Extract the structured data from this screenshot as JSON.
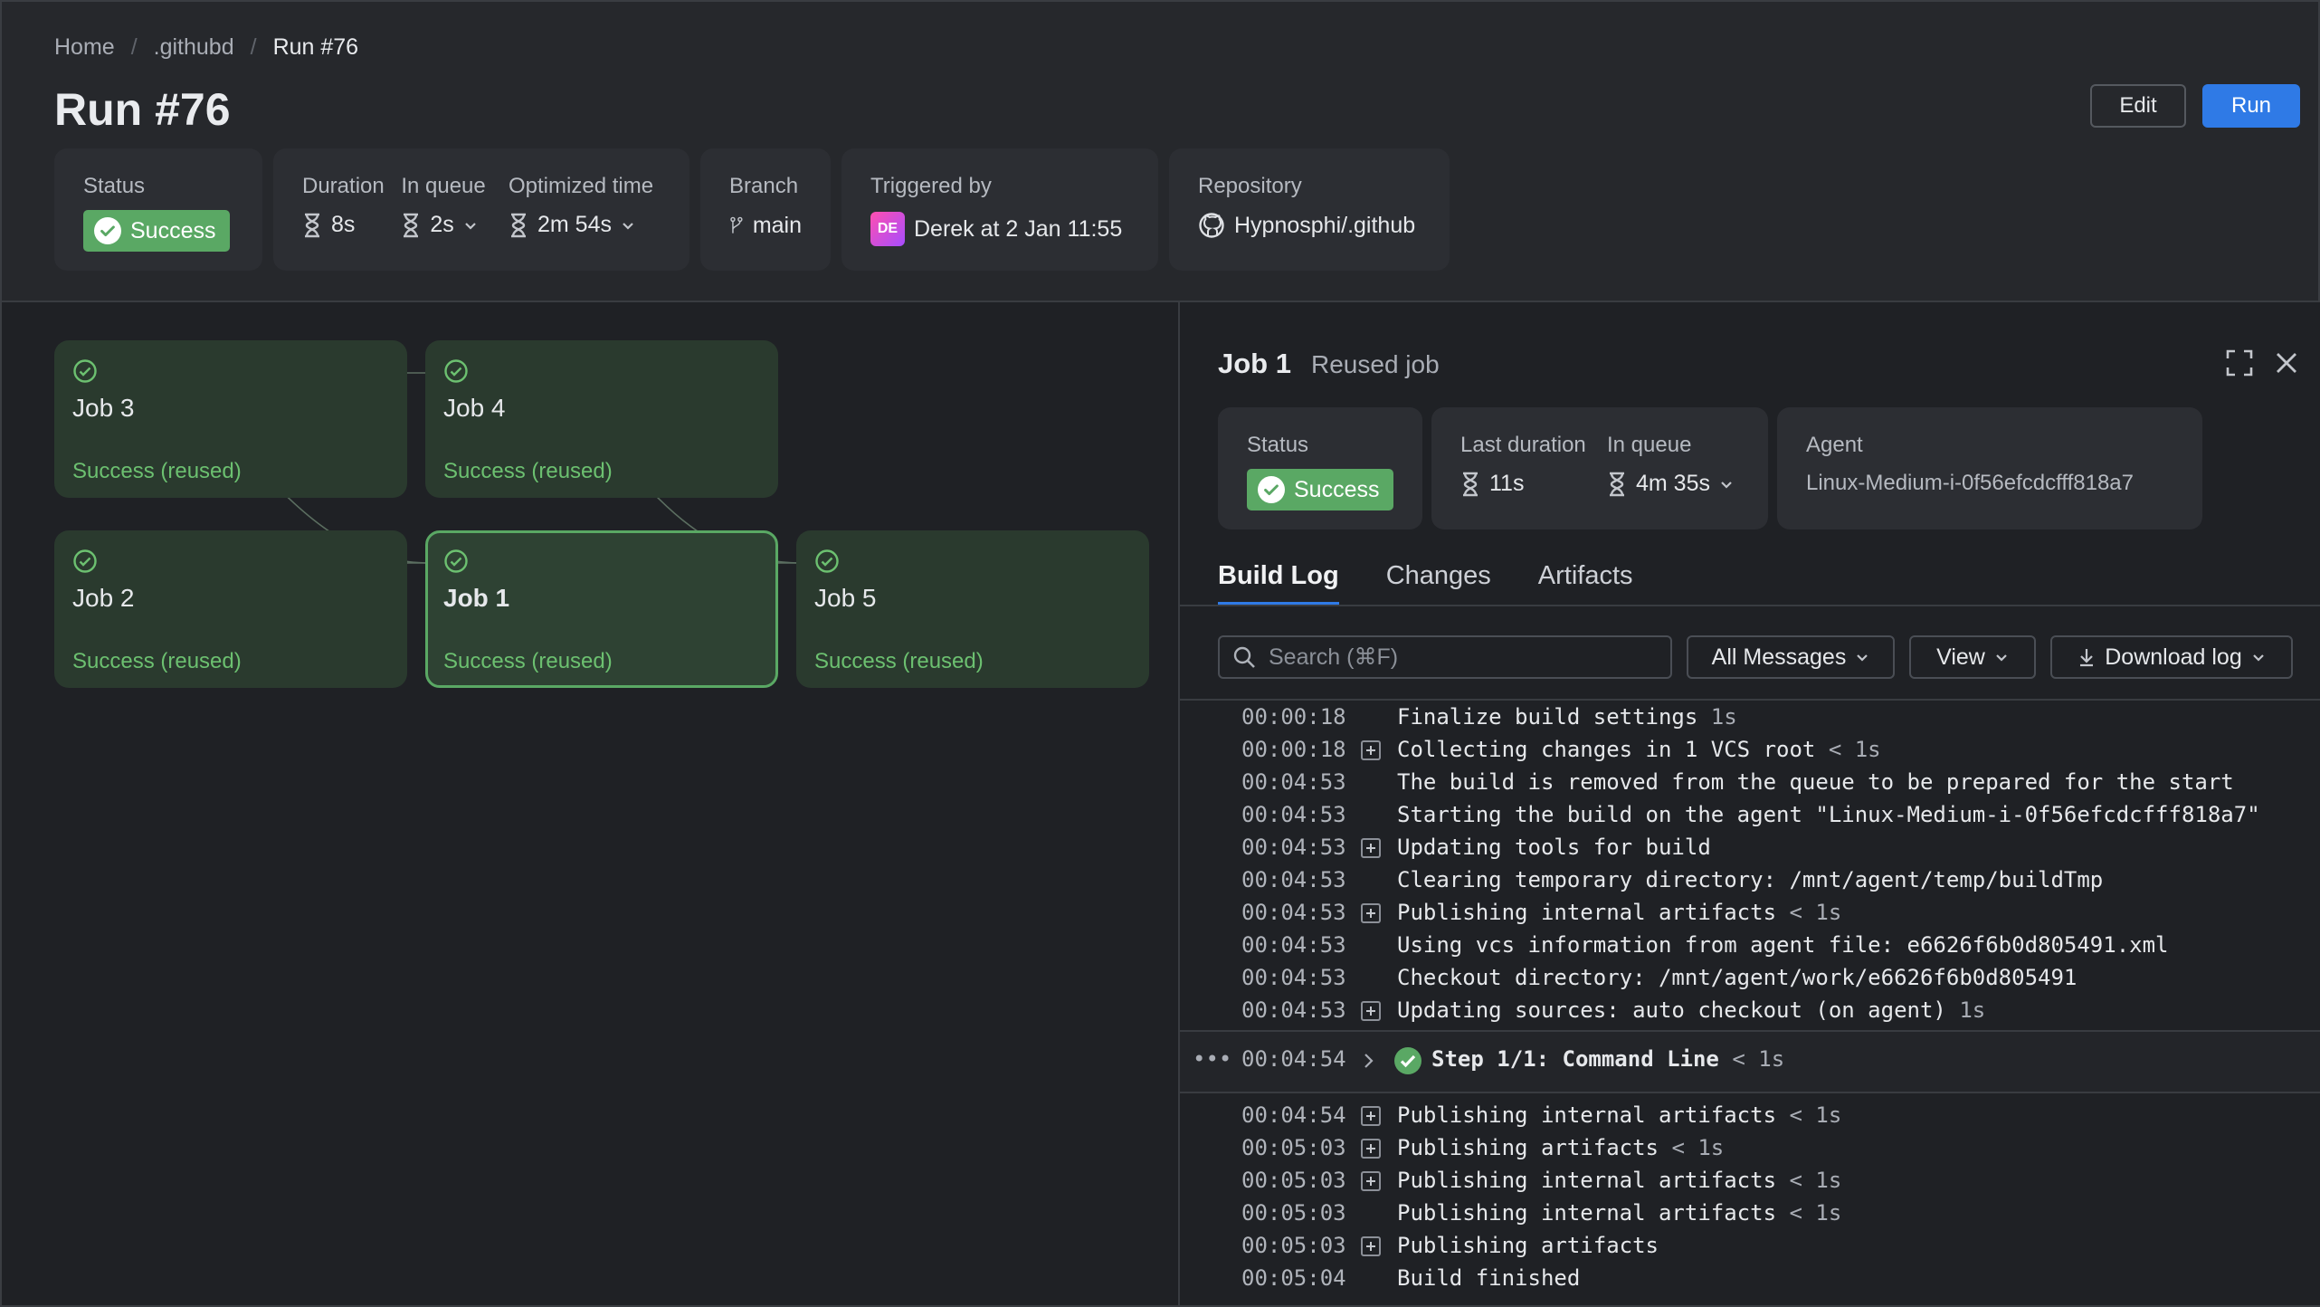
{
  "breadcrumb": {
    "home": "Home",
    "project": ".githubd",
    "current": "Run #76"
  },
  "page": {
    "title": "Run #76",
    "edit_label": "Edit",
    "run_label": "Run"
  },
  "summary": {
    "status_label": "Status",
    "status_value": "Success",
    "duration_label": "Duration",
    "duration_value": "8s",
    "queue_label": "In queue",
    "queue_value": "2s",
    "optimized_label": "Optimized time",
    "optimized_value": "2m 54s",
    "branch_label": "Branch",
    "branch_value": "main",
    "triggered_label": "Triggered by",
    "triggered_avatar": "DE",
    "triggered_value": "Derek at 2 Jan 11:55",
    "repo_label": "Repository",
    "repo_value": "Hypnosphi/.github"
  },
  "colors": {
    "accent": "#2f7ae6",
    "success": "#5aa864",
    "success_text": "#6cc070"
  },
  "jobs": [
    {
      "name": "Job 3",
      "status": "Success (reused)"
    },
    {
      "name": "Job 4",
      "status": "Success (reused)"
    },
    {
      "name": "Job 2",
      "status": "Success (reused)"
    },
    {
      "name": "Job 1",
      "status": "Success (reused)"
    },
    {
      "name": "Job 5",
      "status": "Success (reused)"
    }
  ],
  "panel": {
    "title": "Job 1",
    "subtitle": "Reused job",
    "status_label": "Status",
    "status_value": "Success",
    "last_duration_label": "Last duration",
    "last_duration_value": "11s",
    "queue_label": "In queue",
    "queue_value": "4m 35s",
    "agent_label": "Agent",
    "agent_value": "Linux-Medium-i-0f56efcdcfff818a7",
    "tabs": [
      "Build Log",
      "Changes",
      "Artifacts"
    ],
    "search_placeholder": "Search (⌘F)",
    "filter_label": "All Messages",
    "view_label": "View",
    "download_label": "Download log"
  },
  "log_before": [
    {
      "time": "00:00:18",
      "expandable": false,
      "text": "Finalize build settings",
      "dur": "1s"
    },
    {
      "time": "00:00:18",
      "expandable": true,
      "text": "Collecting changes in 1 VCS root",
      "dur": "< 1s"
    },
    {
      "time": "00:04:53",
      "expandable": false,
      "text": "The build is removed from the queue to be prepared for the start",
      "dur": ""
    },
    {
      "time": "00:04:53",
      "expandable": false,
      "text": "Starting the build on the agent \"Linux-Medium-i-0f56efcdcfff818a7\"",
      "dur": ""
    },
    {
      "time": "00:04:53",
      "expandable": true,
      "text": "Updating tools for build",
      "dur": ""
    },
    {
      "time": "00:04:53",
      "expandable": false,
      "text": "Clearing temporary directory: /mnt/agent/temp/buildTmp",
      "dur": ""
    },
    {
      "time": "00:04:53",
      "expandable": true,
      "text": "Publishing internal artifacts",
      "dur": "< 1s"
    },
    {
      "time": "00:04:53",
      "expandable": false,
      "text": "Using vcs information from agent file: e6626f6b0d805491.xml",
      "dur": ""
    },
    {
      "time": "00:04:53",
      "expandable": false,
      "text": "Checkout directory: /mnt/agent/work/e6626f6b0d805491",
      "dur": ""
    },
    {
      "time": "00:04:53",
      "expandable": true,
      "text": "Updating sources: auto checkout (on agent)",
      "dur": "1s"
    }
  ],
  "step": {
    "dots": "•••",
    "time": "00:04:54",
    "text": "Step 1/1: Command Line",
    "dur": "< 1s"
  },
  "log_after": [
    {
      "time": "00:04:54",
      "expandable": true,
      "text": "Publishing internal artifacts",
      "dur": "< 1s"
    },
    {
      "time": "00:05:03",
      "expandable": true,
      "text": "Publishing artifacts",
      "dur": "< 1s"
    },
    {
      "time": "00:05:03",
      "expandable": true,
      "text": "Publishing internal artifacts",
      "dur": "< 1s"
    },
    {
      "time": "00:05:03",
      "expandable": false,
      "text": "Publishing internal artifacts",
      "dur": "< 1s"
    },
    {
      "time": "00:05:03",
      "expandable": true,
      "text": "Publishing artifacts",
      "dur": ""
    },
    {
      "time": "00:05:04",
      "expandable": false,
      "text": "Build finished",
      "dur": ""
    }
  ]
}
